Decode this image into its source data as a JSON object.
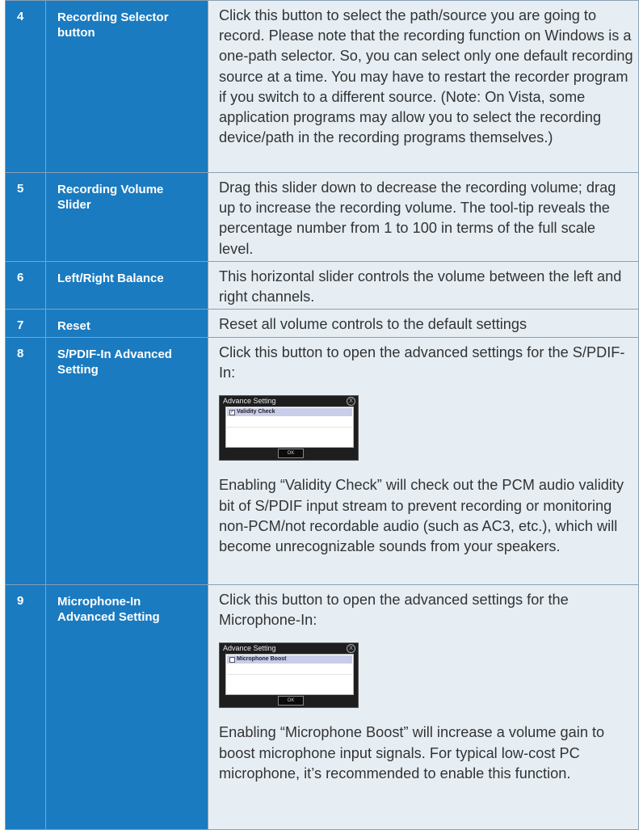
{
  "rows": [
    {
      "num": "4",
      "name": "Recording Selector button",
      "desc": "Click this button to select the path/source you are going to record. Please note that the recording function on Windows is a one-path selector. So, you can select only one default recording source at a time. You may have to restart the recorder program if you switch to a different source. (Note: On Vista, some application programs may allow you to select the recording device/path in the recording programs themselves.)"
    },
    {
      "num": "5",
      "name": "Recording Volume Slider",
      "desc": "Drag this slider down to decrease the recording volume; drag up to increase the recording volume. The tool-tip reveals the percentage number from 1 to 100 in terms of the full scale level."
    },
    {
      "num": "6",
      "name": "Left/Right Balance",
      "desc": "This horizontal slider controls the volume between the left and right channels."
    },
    {
      "num": "7",
      "name": "Reset",
      "desc": "Reset all volume controls to the default settings"
    },
    {
      "num": "8",
      "name": "S/PDIF-In Advanced Setting",
      "desc": "Click this button to open the advanced settings for the S/PDIF-In:",
      "dialog": {
        "title": "Advance Setting",
        "close": "X",
        "option": "Validity Check",
        "checked": true,
        "ok": "OK"
      },
      "desc2": "Enabling “Validity Check” will check out the PCM audio validity bit of S/PDIF input stream to prevent recording or monitoring non-PCM/not recordable audio (such as AC3, etc.), which will become unrecognizable sounds from your speakers."
    },
    {
      "num": "9",
      "name": "Microphone-In Advanced Setting",
      "desc": "Click this button to open the advanced settings for the Microphone-In:",
      "dialog": {
        "title": "Advance Setting",
        "close": "X",
        "option": "Microphone Boost",
        "checked": false,
        "ok": "OK"
      },
      "desc2": "Enabling “Microphone Boost” will increase a volume gain to boost microphone input signals. For typical low-cost PC microphone, it’s recommended to enable this function."
    }
  ],
  "colors": {
    "accent": "#1a7bc0",
    "cell": "#e6eef4",
    "border": "#8aa0b4"
  }
}
